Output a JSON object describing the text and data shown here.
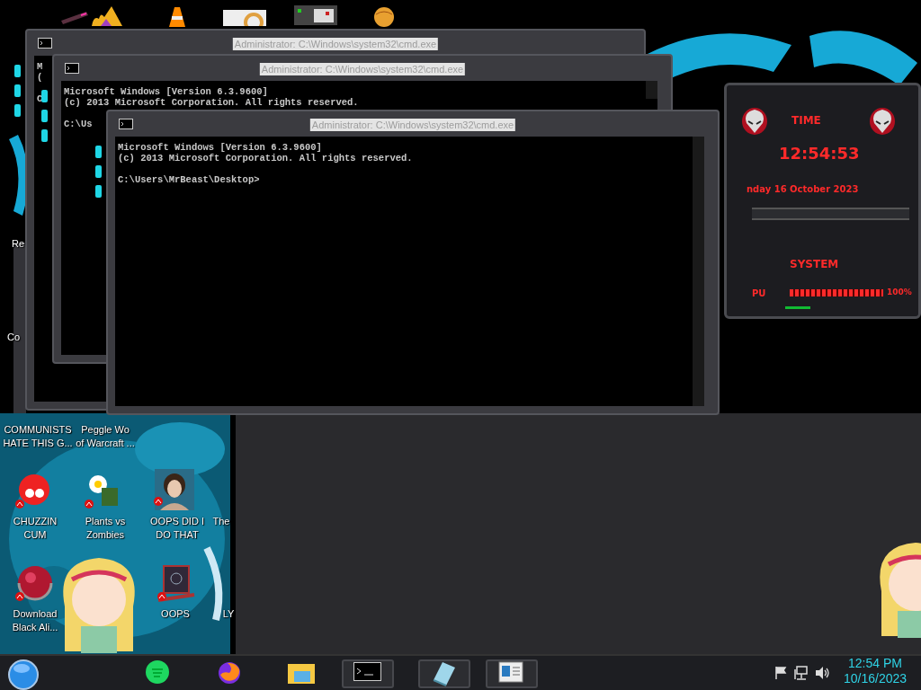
{
  "windows": [
    {
      "title": "Administrator: C:\\Windows\\system32\\cmd.exe",
      "banner": [
        "M",
        "("
      ],
      "prompt": "C"
    },
    {
      "title": "Administrator: C:\\Windows\\system32\\cmd.exe",
      "banner": [
        "Microsoft Windows [Version 6.3.9600]",
        "(c) 2013 Microsoft Corporation. All rights reserved."
      ],
      "prompt": "C:\\Us"
    },
    {
      "title": "Administrator: C:\\Windows\\system32\\cmd.exe",
      "banner": [
        "Microsoft Windows [Version 6.3.9600]",
        "(c) 2013 Microsoft Corporation. All rights reserved."
      ],
      "prompt": "C:\\Users\\MrBeast\\Desktop>"
    }
  ],
  "desktop_icons": [
    {
      "label": "Re"
    },
    {
      "label": "Co"
    },
    {
      "label": "COMMUNISTS\nHATE THIS G..."
    },
    {
      "label": "Peggle Wo\nof Warcraft ..."
    },
    {
      "label": "CHUZZIN\nCUM",
      "kind": "blob"
    },
    {
      "label": "Plants vs\nZombies",
      "kind": "flower"
    },
    {
      "label": "OOPS DID I\nDO THAT",
      "kind": "portrait"
    },
    {
      "label": "The"
    },
    {
      "label": "Download\nBlack Ali...",
      "kind": "sphere"
    },
    {
      "label": "OOPS",
      "kind": "laptop"
    },
    {
      "label": "LY"
    }
  ],
  "clock_widget": {
    "title": "TIME",
    "time": "12:54:53",
    "date": "nday 16 October 2023"
  },
  "system_widget": {
    "title": "SYSTEM",
    "label": "PU",
    "level": 1,
    "reading": "100%"
  },
  "taskbar": {
    "apps": [
      {
        "kind": "music",
        "running": false
      },
      {
        "kind": "browser",
        "running": false
      },
      {
        "kind": "folder",
        "running": false
      },
      {
        "kind": "terminal",
        "running": true
      },
      {
        "kind": "notepad",
        "running": true
      },
      {
        "kind": "document",
        "running": true
      }
    ]
  },
  "tray": {
    "time": "12:54 PM",
    "date": "10/16/2023"
  }
}
